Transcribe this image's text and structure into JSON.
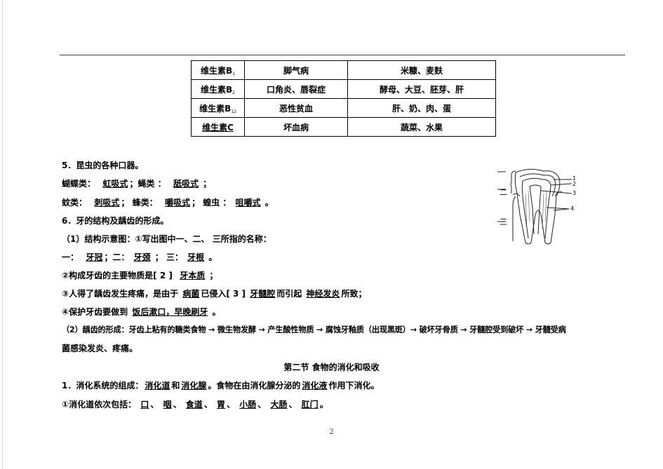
{
  "table": {
    "rows": [
      {
        "vitamin": "维生素B",
        "sub": "1",
        "disease": "脚气病",
        "sources": "米糠、麦麸"
      },
      {
        "vitamin": "维生素B",
        "sub": "2",
        "disease": "口角炎、唇裂症",
        "sources": "酵母、大豆、胚芽、肝"
      },
      {
        "vitamin": "维生素B",
        "sub": "12",
        "disease": "恶性贫血",
        "sources": "肝、奶、肉、蛋"
      },
      {
        "vitamin": "维生素C",
        "sub": "",
        "disease": "坏血病",
        "sources": "蔬菜、水果"
      }
    ]
  },
  "q5": {
    "title": "5．昆虫的各种口器。",
    "l1": {
      "a": "蝴蝶类：",
      "b": "虹吸式",
      "c": "；蝇类 ：",
      "d": "舐吸式",
      "e": "；"
    },
    "l2": {
      "a": "蚊类：",
      "b": "刺吸式",
      "c": "；  蜂类：",
      "d": "嚼吸式",
      "e": "；  蝗虫 ：",
      "f": "咀嚼式",
      "g": "。"
    }
  },
  "q6": {
    "title": "6．牙的结构及龋齿的形成。",
    "p1": "（1）结构示意图：①写出图中一、二、 三所指的名称：",
    "names": {
      "l1": "一：",
      "v1": "牙冠",
      "l2": "；二：",
      "v2": "牙颈",
      "l3": "；  三：",
      "v3": "牙根",
      "end": "。"
    },
    "p2": {
      "a": "②构成牙齿的主要物质是[ 2  ] ",
      "b": "牙本质",
      "c": "；"
    },
    "p3": {
      "a": "③人得了龋齿发生疼痛，是由于 ",
      "b": "病菌",
      "c": "已侵入[ 3 ] ",
      "d": "牙髓腔",
      "e": "而引起 ",
      "f": "神经发炎",
      "g": "所致；"
    },
    "p4": {
      "a": "④保护牙齿要做到 ",
      "b": "饭后漱口，早晚刷牙",
      "c": "。"
    },
    "p5a": "（2）龋齿的形成：牙齿上粘有的糖类食物 → 微生物发酵 → 产生酸性物质 → 腐蚀牙釉质（出现黑斑）→ 破坏牙骨质 → 牙髓腔受到破坏 → 牙髓受病",
    "p5b": "菌感染发炎、疼痛。"
  },
  "section": {
    "title": "第二节  食物的消化和吸收"
  },
  "s1": {
    "line1": {
      "a": "1．消化系统的组成：",
      "b": "消化道",
      "c": "和",
      "d": "消化腺",
      "e": "。食物在由消化腺分泌的",
      "f": "消化液",
      "g": "作用下消化。"
    },
    "line2": {
      "a": "①消化道依次包括：",
      "i1": "口",
      "i2": "咽",
      "i3": "食道",
      "i4": "胃",
      "i5": "小肠",
      "i6": "大肠",
      "i7": "肛门",
      "sep": "、",
      "end": "。"
    }
  },
  "figure": {
    "labels": {
      "one": "一",
      "two": "二",
      "three": "三",
      "n1": "1",
      "n2": "2",
      "n3": "3",
      "n4": "4"
    }
  },
  "page_number": "2"
}
